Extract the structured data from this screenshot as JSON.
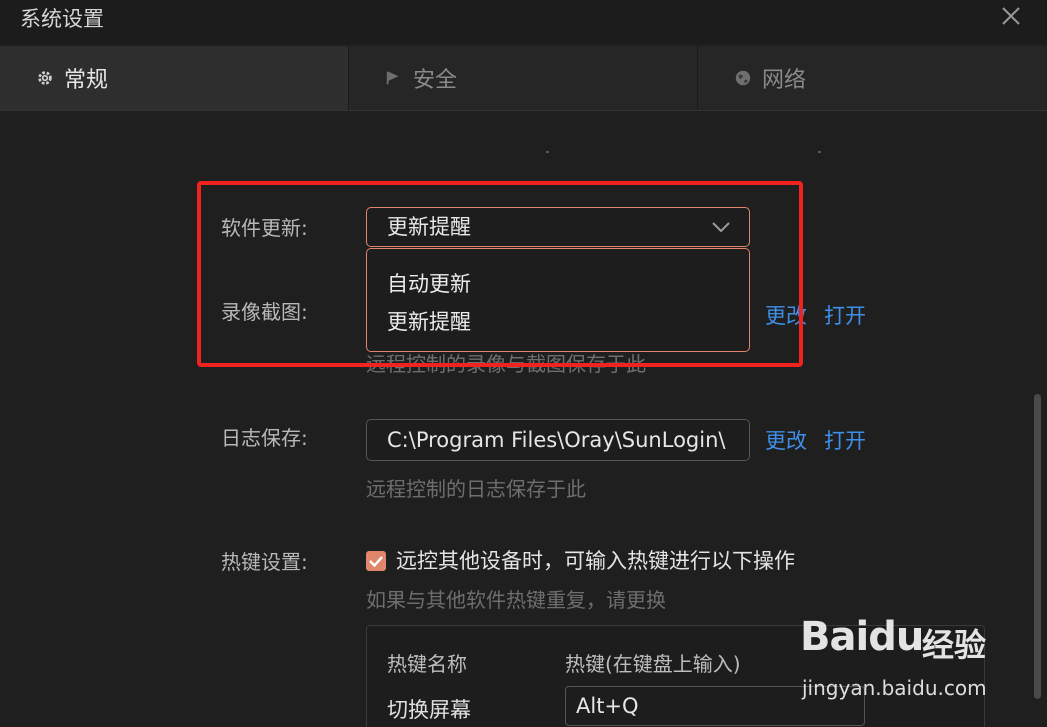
{
  "window": {
    "title": "系统设置"
  },
  "tabs": [
    {
      "label": "常规",
      "icon": "gear-icon",
      "active": true
    },
    {
      "label": "安全",
      "icon": "flag-icon",
      "active": false
    },
    {
      "label": "网络",
      "icon": "globe-icon",
      "active": false
    }
  ],
  "settings": {
    "software_update": {
      "label": "软件更新:",
      "selected": "更新提醒",
      "options": [
        "自动更新",
        "更新提醒"
      ]
    },
    "recording": {
      "label": "录像截图:",
      "hint": "远程控制的录像与截图保存于此",
      "change_label": "更改",
      "open_label": "打开"
    },
    "log": {
      "label": "日志保存:",
      "path": "C:\\Program Files\\Oray\\SunLogin\\",
      "hint": "远程控制的日志保存于此",
      "change_label": "更改",
      "open_label": "打开"
    },
    "hotkey": {
      "label": "热键设置:",
      "checkbox_label": "远控其他设备时，可输入热键进行以下操作",
      "checked": true,
      "hint": "如果与其他软件热键重复，请更换",
      "col_name": "热键名称",
      "col_key": "热键(在键盘上输入)",
      "rows": [
        {
          "name": "切换屏幕",
          "key": "Alt+Q"
        }
      ]
    }
  },
  "watermark": {
    "brand": "Baidu",
    "cn": "经验",
    "url": "jingyan.baidu.com"
  },
  "colors": {
    "accent": "#e0876b",
    "link": "#3f8fe8",
    "annotation": "#f0231e"
  }
}
